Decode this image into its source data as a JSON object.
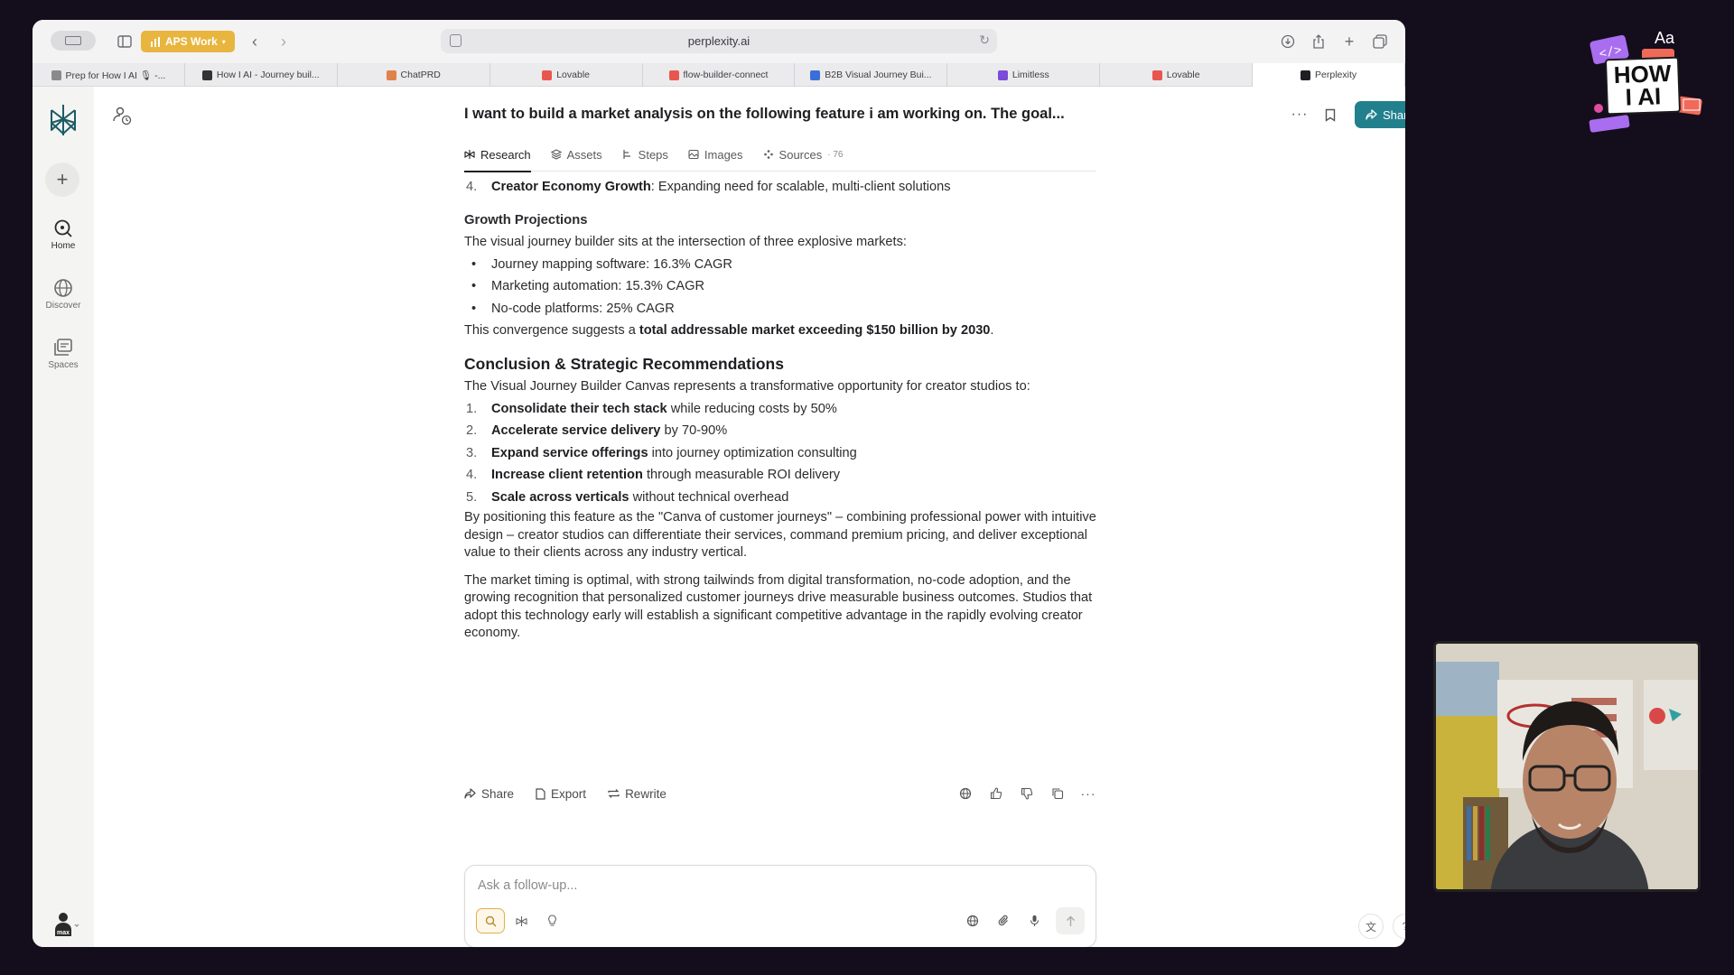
{
  "browser": {
    "workspace": "APS Work",
    "url": "perplexity.ai",
    "tabs": [
      {
        "title": "Prep for How I AI 🎙 -...",
        "color": "#8a8a8a",
        "active": false
      },
      {
        "title": "How I AI - Journey buil...",
        "color": "#333333",
        "active": false
      },
      {
        "title": "ChatPRD",
        "color": "#e0824a",
        "active": false
      },
      {
        "title": "Lovable",
        "color": "#e8574f",
        "active": false
      },
      {
        "title": "flow-builder-connect",
        "color": "#e8574f",
        "active": false
      },
      {
        "title": "B2B Visual Journey Bui...",
        "color": "#3b6fd8",
        "active": false
      },
      {
        "title": "Limitless",
        "color": "#7b4ad8",
        "active": false
      },
      {
        "title": "Lovable",
        "color": "#e8574f",
        "active": false
      },
      {
        "title": "Perplexity",
        "color": "#1f1f23",
        "active": true
      }
    ]
  },
  "rail": {
    "items": [
      {
        "label": "Home",
        "icon": "home-search-icon"
      },
      {
        "label": "Discover",
        "icon": "globe-icon"
      },
      {
        "label": "Spaces",
        "icon": "spaces-icon"
      }
    ],
    "user_label": "max"
  },
  "thread": {
    "title": "I want to build a market analysis on the following feature i am working on. The goal...",
    "share_label": "Share",
    "subtabs": [
      {
        "label": "Research",
        "active": true
      },
      {
        "label": "Assets",
        "active": false
      },
      {
        "label": "Steps",
        "active": false
      },
      {
        "label": "Images",
        "active": false
      },
      {
        "label": "Sources",
        "count": "76",
        "active": false
      }
    ]
  },
  "answer": {
    "top_item": {
      "num": "4.",
      "bold": "Creator Economy Growth",
      "rest": ": Expanding need for scalable, multi-client solutions"
    },
    "growth_heading": "Growth Projections",
    "growth_intro": "The visual journey builder sits at the intersection of three explosive markets:",
    "growth_bullets": [
      "Journey mapping software: 16.3% CAGR",
      "Marketing automation: 15.3% CAGR",
      "No-code platforms: 25% CAGR"
    ],
    "convergence_pre": "This convergence suggests a ",
    "convergence_bold": "total addressable market exceeding $150 billion by 2030",
    "convergence_post": ".",
    "conclusion_heading": "Conclusion & Strategic Recommendations",
    "conclusion_intro": "The Visual Journey Builder Canvas represents a transformative opportunity for creator studios to:",
    "recommendations": [
      {
        "num": "1.",
        "bold": "Consolidate their tech stack",
        "rest": " while reducing costs by 50%"
      },
      {
        "num": "2.",
        "bold": "Accelerate service delivery",
        "rest": " by 70-90%"
      },
      {
        "num": "3.",
        "bold": "Expand service offerings",
        "rest": " into journey optimization consulting"
      },
      {
        "num": "4.",
        "bold": "Increase client retention",
        "rest": " through measurable ROI delivery"
      },
      {
        "num": "5.",
        "bold": "Scale across verticals",
        "rest": " without technical overhead"
      }
    ],
    "paragraph1": "By positioning this feature as the \"Canva of customer journeys\" – combining professional power with intuitive design – creator studios can differentiate their services, command premium pricing, and deliver exceptional value to their clients across any industry vertical.",
    "paragraph2": "The market timing is optimal, with strong tailwinds from digital transformation, no-code adoption, and the growing recognition that personalized customer journeys drive measurable business outcomes. Studios that adopt this technology early will establish a significant competitive advantage in the rapidly evolving creator economy."
  },
  "answer_actions": {
    "share": "Share",
    "export": "Export",
    "rewrite": "Rewrite"
  },
  "followup": {
    "placeholder": "Ask a follow-up..."
  },
  "overlay": {
    "brand_line1": "HOW",
    "brand_line2": "I AI",
    "brand_aa": "Aa"
  }
}
